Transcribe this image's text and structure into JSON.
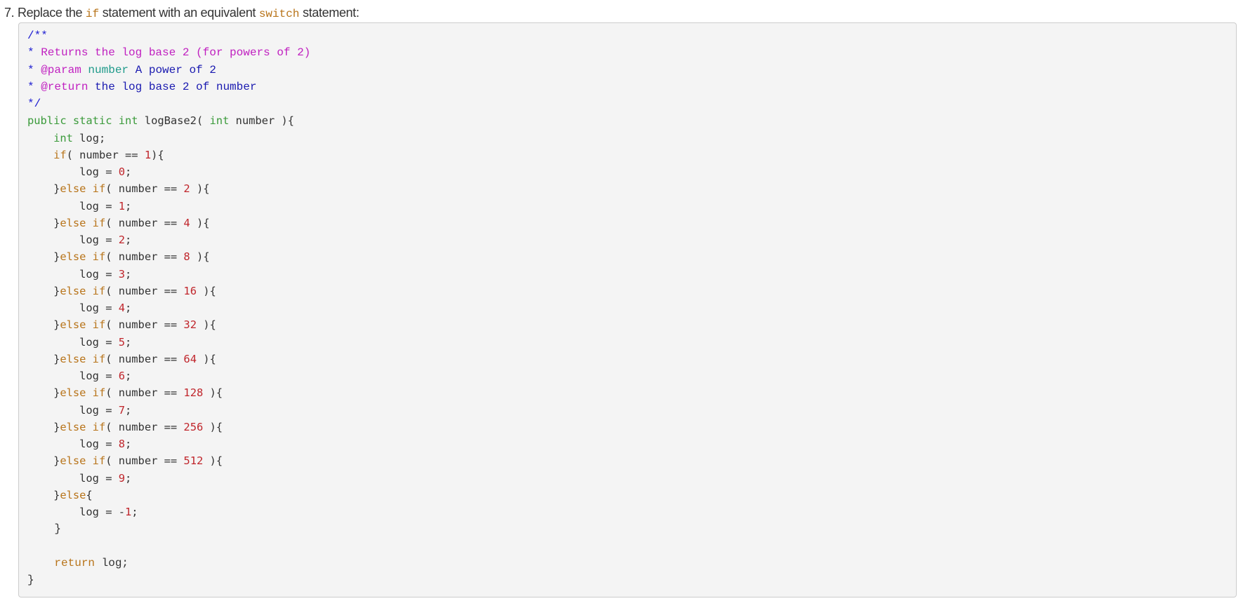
{
  "heading": {
    "number": "7.",
    "text_before": " Replace the ",
    "code_1": "if",
    "text_middle": " statement with an equivalent ",
    "code_2": "switch",
    "text_after": " statement:"
  },
  "colors": {
    "code_background": "#f4f4f4",
    "keyword_type": "#3a9a3a",
    "keyword_control": "#b8741a",
    "number_literal": "#c0262c",
    "comment_marker": "#1a1ad0",
    "doc_tag": "#c020c0",
    "doc_param_name": "#1e9a8a",
    "doc_text": "#1a1ab0"
  },
  "code_lines": [
    {
      "font": "serif",
      "tokens": [
        {
          "t": "/**",
          "c": "cstar"
        }
      ]
    },
    {
      "font": "serif",
      "tokens": [
        {
          "t": "* ",
          "c": "cstar"
        },
        {
          "t": "Returns the log base 2 (for powers of 2)",
          "c": "cdoc"
        }
      ]
    },
    {
      "font": "serif",
      "tokens": [
        {
          "t": "* ",
          "c": "cstar"
        },
        {
          "t": "@param",
          "c": "cdoc"
        },
        {
          "t": " ",
          "c": "ctext"
        },
        {
          "t": "number",
          "c": "cparam"
        },
        {
          "t": " A power of 2",
          "c": "ctext"
        }
      ]
    },
    {
      "font": "serif",
      "tokens": [
        {
          "t": "* ",
          "c": "cstar"
        },
        {
          "t": "@return",
          "c": "cdoc"
        },
        {
          "t": " the log base 2 of number",
          "c": "ctext"
        }
      ]
    },
    {
      "font": "serif",
      "tokens": [
        {
          "t": "*/",
          "c": "cstar"
        }
      ]
    },
    {
      "font": "sans",
      "tokens": [
        {
          "t": "public static int",
          "c": "kw"
        },
        {
          "t": " logBase2( ",
          "c": "plain"
        },
        {
          "t": "int",
          "c": "kw"
        },
        {
          "t": " number ){",
          "c": "plain"
        }
      ]
    },
    {
      "font": "sans",
      "tokens": [
        {
          "t": "    ",
          "c": "plain"
        },
        {
          "t": "int",
          "c": "kw"
        },
        {
          "t": " log;",
          "c": "plain"
        }
      ]
    },
    {
      "font": "sans",
      "tokens": [
        {
          "t": "    ",
          "c": "plain"
        },
        {
          "t": "if",
          "c": "ctl"
        },
        {
          "t": "( number == ",
          "c": "plain"
        },
        {
          "t": "1",
          "c": "num"
        },
        {
          "t": "){",
          "c": "plain"
        }
      ]
    },
    {
      "font": "sans",
      "tokens": [
        {
          "t": "        log = ",
          "c": "plain"
        },
        {
          "t": "0",
          "c": "num"
        },
        {
          "t": ";",
          "c": "plain"
        }
      ]
    },
    {
      "font": "sans",
      "tokens": [
        {
          "t": "    }",
          "c": "plain"
        },
        {
          "t": "else if",
          "c": "ctl"
        },
        {
          "t": "( number == ",
          "c": "plain"
        },
        {
          "t": "2",
          "c": "num"
        },
        {
          "t": " ){",
          "c": "plain"
        }
      ]
    },
    {
      "font": "sans",
      "tokens": [
        {
          "t": "        log = ",
          "c": "plain"
        },
        {
          "t": "1",
          "c": "num"
        },
        {
          "t": ";",
          "c": "plain"
        }
      ]
    },
    {
      "font": "sans",
      "tokens": [
        {
          "t": "    }",
          "c": "plain"
        },
        {
          "t": "else if",
          "c": "ctl"
        },
        {
          "t": "( number == ",
          "c": "plain"
        },
        {
          "t": "4",
          "c": "num"
        },
        {
          "t": " ){",
          "c": "plain"
        }
      ]
    },
    {
      "font": "sans",
      "tokens": [
        {
          "t": "        log = ",
          "c": "plain"
        },
        {
          "t": "2",
          "c": "num"
        },
        {
          "t": ";",
          "c": "plain"
        }
      ]
    },
    {
      "font": "sans",
      "tokens": [
        {
          "t": "    }",
          "c": "plain"
        },
        {
          "t": "else if",
          "c": "ctl"
        },
        {
          "t": "( number == ",
          "c": "plain"
        },
        {
          "t": "8",
          "c": "num"
        },
        {
          "t": " ){",
          "c": "plain"
        }
      ]
    },
    {
      "font": "sans",
      "tokens": [
        {
          "t": "        log = ",
          "c": "plain"
        },
        {
          "t": "3",
          "c": "num"
        },
        {
          "t": ";",
          "c": "plain"
        }
      ]
    },
    {
      "font": "sans",
      "tokens": [
        {
          "t": "    }",
          "c": "plain"
        },
        {
          "t": "else if",
          "c": "ctl"
        },
        {
          "t": "( number == ",
          "c": "plain"
        },
        {
          "t": "16",
          "c": "num"
        },
        {
          "t": " ){",
          "c": "plain"
        }
      ]
    },
    {
      "font": "sans",
      "tokens": [
        {
          "t": "        log = ",
          "c": "plain"
        },
        {
          "t": "4",
          "c": "num"
        },
        {
          "t": ";",
          "c": "plain"
        }
      ]
    },
    {
      "font": "sans",
      "tokens": [
        {
          "t": "    }",
          "c": "plain"
        },
        {
          "t": "else if",
          "c": "ctl"
        },
        {
          "t": "( number == ",
          "c": "plain"
        },
        {
          "t": "32",
          "c": "num"
        },
        {
          "t": " ){",
          "c": "plain"
        }
      ]
    },
    {
      "font": "sans",
      "tokens": [
        {
          "t": "        log = ",
          "c": "plain"
        },
        {
          "t": "5",
          "c": "num"
        },
        {
          "t": ";",
          "c": "plain"
        }
      ]
    },
    {
      "font": "sans",
      "tokens": [
        {
          "t": "    }",
          "c": "plain"
        },
        {
          "t": "else if",
          "c": "ctl"
        },
        {
          "t": "( number == ",
          "c": "plain"
        },
        {
          "t": "64",
          "c": "num"
        },
        {
          "t": " ){",
          "c": "plain"
        }
      ]
    },
    {
      "font": "sans",
      "tokens": [
        {
          "t": "        log = ",
          "c": "plain"
        },
        {
          "t": "6",
          "c": "num"
        },
        {
          "t": ";",
          "c": "plain"
        }
      ]
    },
    {
      "font": "sans",
      "tokens": [
        {
          "t": "    }",
          "c": "plain"
        },
        {
          "t": "else if",
          "c": "ctl"
        },
        {
          "t": "( number == ",
          "c": "plain"
        },
        {
          "t": "128",
          "c": "num"
        },
        {
          "t": " ){",
          "c": "plain"
        }
      ]
    },
    {
      "font": "sans",
      "tokens": [
        {
          "t": "        log = ",
          "c": "plain"
        },
        {
          "t": "7",
          "c": "num"
        },
        {
          "t": ";",
          "c": "plain"
        }
      ]
    },
    {
      "font": "sans",
      "tokens": [
        {
          "t": "    }",
          "c": "plain"
        },
        {
          "t": "else if",
          "c": "ctl"
        },
        {
          "t": "( number == ",
          "c": "plain"
        },
        {
          "t": "256",
          "c": "num"
        },
        {
          "t": " ){",
          "c": "plain"
        }
      ]
    },
    {
      "font": "sans",
      "tokens": [
        {
          "t": "        log = ",
          "c": "plain"
        },
        {
          "t": "8",
          "c": "num"
        },
        {
          "t": ";",
          "c": "plain"
        }
      ]
    },
    {
      "font": "sans",
      "tokens": [
        {
          "t": "    }",
          "c": "plain"
        },
        {
          "t": "else if",
          "c": "ctl"
        },
        {
          "t": "( number == ",
          "c": "plain"
        },
        {
          "t": "512",
          "c": "num"
        },
        {
          "t": " ){",
          "c": "plain"
        }
      ]
    },
    {
      "font": "sans",
      "tokens": [
        {
          "t": "        log = ",
          "c": "plain"
        },
        {
          "t": "9",
          "c": "num"
        },
        {
          "t": ";",
          "c": "plain"
        }
      ]
    },
    {
      "font": "sans",
      "tokens": [
        {
          "t": "    }",
          "c": "plain"
        },
        {
          "t": "else",
          "c": "ctl"
        },
        {
          "t": "{",
          "c": "plain"
        }
      ]
    },
    {
      "font": "sans",
      "tokens": [
        {
          "t": "        log = -",
          "c": "plain"
        },
        {
          "t": "1",
          "c": "num"
        },
        {
          "t": ";",
          "c": "plain"
        }
      ]
    },
    {
      "font": "serif",
      "tokens": [
        {
          "t": "    }",
          "c": "plain"
        }
      ]
    },
    {
      "font": "serif",
      "tokens": [
        {
          "t": "",
          "c": "plain"
        }
      ]
    },
    {
      "font": "serif",
      "tokens": [
        {
          "t": "    ",
          "c": "plain"
        },
        {
          "t": "return",
          "c": "ctl"
        },
        {
          "t": " log;",
          "c": "plain"
        }
      ]
    },
    {
      "font": "serif",
      "tokens": [
        {
          "t": "}",
          "c": "plain"
        }
      ]
    }
  ]
}
